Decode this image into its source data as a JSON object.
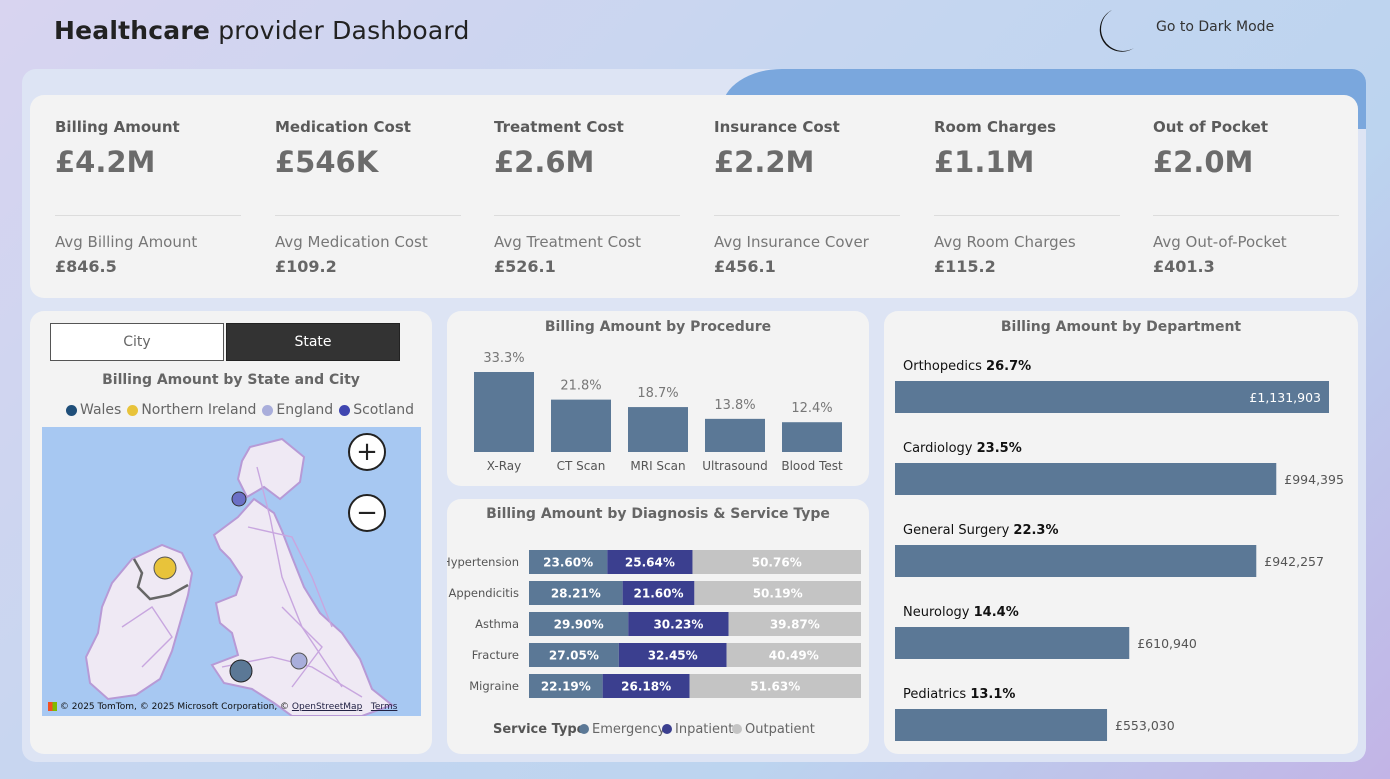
{
  "header": {
    "title_bold": "Healthcare",
    "title_rest": " provider Dashboard",
    "dark_mode_label": "Go to Dark Mode"
  },
  "kpis": [
    {
      "label": "Billing Amount",
      "value": "£4.2M",
      "avg_label": "Avg Billing Amount",
      "avg_value": "£846.5"
    },
    {
      "label": "Medication Cost",
      "value": "£546K",
      "avg_label": "Avg Medication Cost",
      "avg_value": "£109.2"
    },
    {
      "label": "Treatment Cost",
      "value": "£2.6M",
      "avg_label": "Avg Treatment Cost",
      "avg_value": "£526.1"
    },
    {
      "label": "Insurance Cost",
      "value": "£2.2M",
      "avg_label": "Avg Insurance Cover",
      "avg_value": "£456.1"
    },
    {
      "label": "Room Charges",
      "value": "£1.1M",
      "avg_label": "Avg Room Charges",
      "avg_value": "£115.2"
    },
    {
      "label": "Out of Pocket",
      "value": "£2.0M",
      "avg_label": "Avg Out-of-Pocket",
      "avg_value": "£401.3"
    }
  ],
  "map": {
    "toggle_city": "City",
    "toggle_state": "State",
    "selected": "State",
    "title": "Billing Amount by State and City",
    "legend": [
      {
        "name": "Wales",
        "color": "#1f4e79"
      },
      {
        "name": "Northern Ireland",
        "color": "#e8c33a"
      },
      {
        "name": "England",
        "color": "#a9aedb"
      },
      {
        "name": "Scotland",
        "color": "#3f46b0"
      }
    ],
    "zoom_in": "+",
    "zoom_out": "−",
    "attribution_logo": "Microsoft",
    "attribution_text": "© 2025 TomTom, © 2025 Microsoft Corporation, © ",
    "attribution_osm": "OpenStreetMap",
    "attribution_terms": "Terms"
  },
  "chart_data": [
    {
      "type": "bar",
      "title": "Billing Amount by Procedure",
      "categories": [
        "X-Ray",
        "CT Scan",
        "MRI Scan",
        "Ultrasound",
        "Blood Test"
      ],
      "values": [
        33.3,
        21.8,
        18.7,
        13.8,
        12.4
      ],
      "labels": [
        "33.3%",
        "21.8%",
        "18.7%",
        "13.8%",
        "12.4%"
      ],
      "color": "#5b7896"
    },
    {
      "type": "bar",
      "stacked": true,
      "orientation": "horizontal",
      "title": "Billing Amount by Diagnosis & Service Type",
      "legend_title": "Service Type",
      "categories": [
        "Hypertension",
        "Appendicitis",
        "Asthma",
        "Fracture",
        "Migraine"
      ],
      "series": [
        {
          "name": "Emergency",
          "color": "#5b7896",
          "values": [
            23.6,
            28.21,
            29.9,
            27.05,
            22.19
          ],
          "labels": [
            "23.60%",
            "28.21%",
            "29.90%",
            "27.05%",
            "22.19%"
          ]
        },
        {
          "name": "Inpatient",
          "color": "#3b3f8f",
          "values": [
            25.64,
            21.6,
            30.23,
            32.45,
            26.18
          ],
          "labels": [
            "25.64%",
            "21.60%",
            "30.23%",
            "32.45%",
            "26.18%"
          ]
        },
        {
          "name": "Outpatient",
          "color": "#c4c4c4",
          "values": [
            50.76,
            50.19,
            39.87,
            40.49,
            51.63
          ],
          "labels": [
            "50.76%",
            "50.19%",
            "39.87%",
            "40.49%",
            "51.63%"
          ]
        }
      ]
    },
    {
      "type": "bar",
      "orientation": "horizontal",
      "title": "Billing Amount by Department",
      "categories": [
        "Orthopedics",
        "Cardiology",
        "General Surgery",
        "Neurology",
        "Pediatrics"
      ],
      "percent_labels": [
        "26.7%",
        "23.5%",
        "22.3%",
        "14.4%",
        "13.1%"
      ],
      "values": [
        1131903,
        994395,
        942257,
        610940,
        553030
      ],
      "value_labels": [
        "£1,131,903",
        "£994,395",
        "£942,257",
        "£610,940",
        "£553,030"
      ],
      "color": "#5b7896"
    }
  ]
}
